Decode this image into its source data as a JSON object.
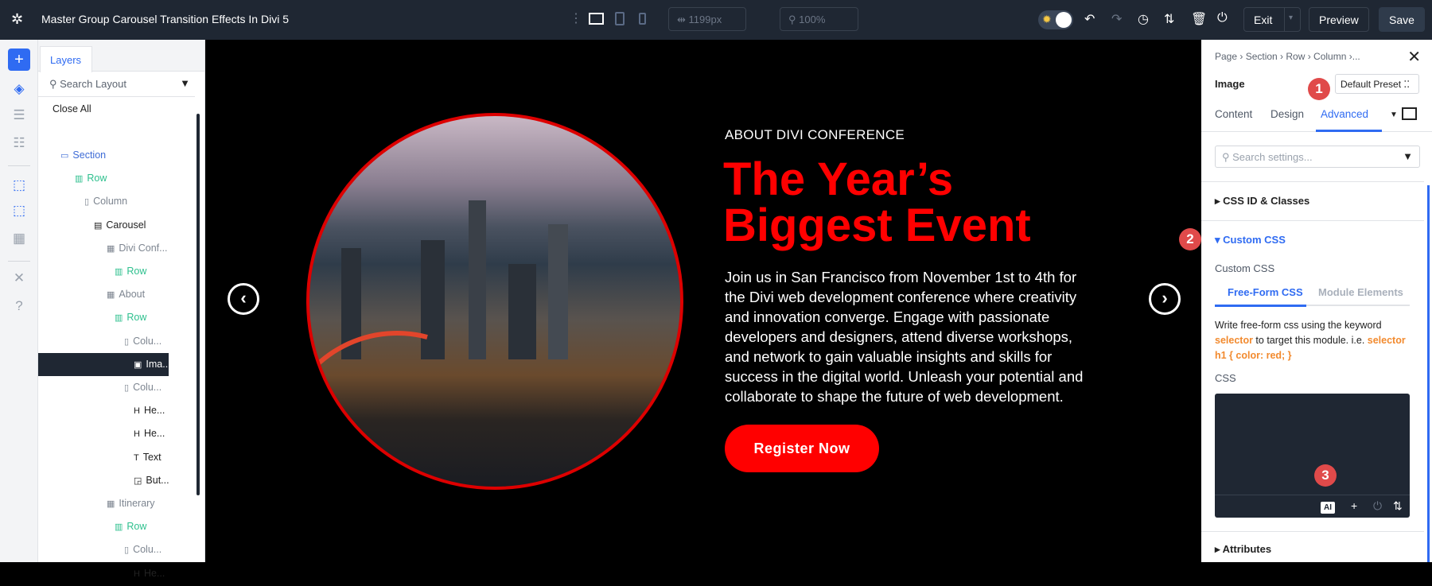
{
  "topbar": {
    "title": "Master Group Carousel Transition Effects In Divi 5",
    "width_value": "1199px",
    "zoom_value": "100%",
    "exit_label": "Exit",
    "preview_label": "Preview",
    "save_label": "Save"
  },
  "layers": {
    "tab_label": "Layers",
    "search_placeholder": "Search Layout",
    "close_all": "Close All",
    "items": [
      {
        "label": "Section",
        "icon": "section-icon"
      },
      {
        "label": "Row",
        "icon": "row-icon"
      },
      {
        "label": "Column",
        "icon": "column-icon"
      },
      {
        "label": "Carousel",
        "icon": "carousel-icon"
      },
      {
        "label": "Divi Conf...",
        "icon": "slide-icon"
      },
      {
        "label": "Row",
        "icon": "row-icon"
      },
      {
        "label": "About",
        "icon": "slide-icon"
      },
      {
        "label": "Row",
        "icon": "row-icon"
      },
      {
        "label": "Colu...",
        "icon": "column-icon"
      },
      {
        "label": "Ima...",
        "icon": "image-icon"
      },
      {
        "label": "Colu...",
        "icon": "column-icon"
      },
      {
        "label": "He...",
        "icon": "heading-icon"
      },
      {
        "label": "He...",
        "icon": "heading-icon"
      },
      {
        "label": "Text",
        "icon": "text-icon"
      },
      {
        "label": "But...",
        "icon": "button-icon"
      },
      {
        "label": "Itinerary",
        "icon": "slide-icon"
      },
      {
        "label": "Row",
        "icon": "row-icon"
      },
      {
        "label": "Colu...",
        "icon": "column-icon"
      },
      {
        "label": "He...",
        "icon": "heading-icon"
      }
    ]
  },
  "canvas": {
    "kicker": "ABOUT DIVI CONFERENCE",
    "headline_line1": "The Year’s",
    "headline_line2": "Biggest Event",
    "paragraph": "Join us in San Francisco from November 1st to 4th for the Divi web development conference where creativity and innovation converge. Engage with passionate developers and designers, attend diverse workshops, and network to gain valuable insights and skills for success in the digital world. Unleash your potential and collaborate to shape the future of web development.",
    "cta_label": "Register Now",
    "accent": "#ff0000"
  },
  "settings": {
    "breadcrumb": "Page › Section › Row › Column ›...",
    "module_title": "Image",
    "preset_label": "Default Preset",
    "tabs": [
      "Content",
      "Design",
      "Advanced"
    ],
    "search_placeholder": "Search settings...",
    "groups": {
      "css_id": "CSS ID & Classes",
      "custom_css": "Custom CSS",
      "attributes": "Attributes"
    },
    "custom_css_label": "Custom CSS",
    "subtabs": [
      "Free-Form CSS",
      "Module Elements"
    ],
    "desc_1": "Write free-form css using the keyword ",
    "desc_kw1": "selector",
    "desc_2": " to target this module. i.e. ",
    "desc_kw2": "selector h1 { color: red; }",
    "css_label": "CSS",
    "ai_label": "AI"
  },
  "badges": [
    "1",
    "2",
    "3"
  ]
}
